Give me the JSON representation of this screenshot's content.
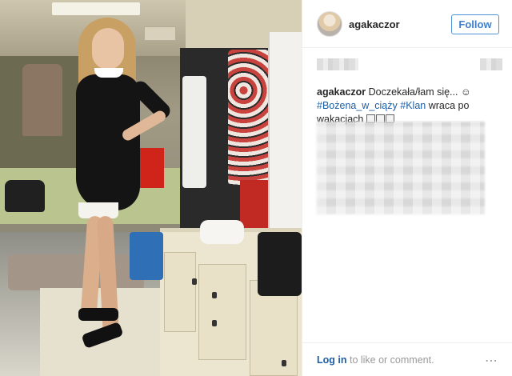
{
  "post": {
    "username": "agakaczor",
    "follow_label": "Follow",
    "caption_user": "agakaczor",
    "caption_text": " Doczekała/łam się... ☺",
    "tag1": "#Bożena_w_ciąży",
    "tag2": "#Klan",
    "caption_rest": " wraca po wakacjach"
  },
  "footer": {
    "login_link": "Log in",
    "login_rest": " to like or comment.",
    "more": "⋯"
  },
  "colors": {
    "link": "#1b5ea8",
    "follow_border": "#4f93d6"
  },
  "icons": {
    "avatar": "avatar",
    "more": "more-options-icon"
  }
}
